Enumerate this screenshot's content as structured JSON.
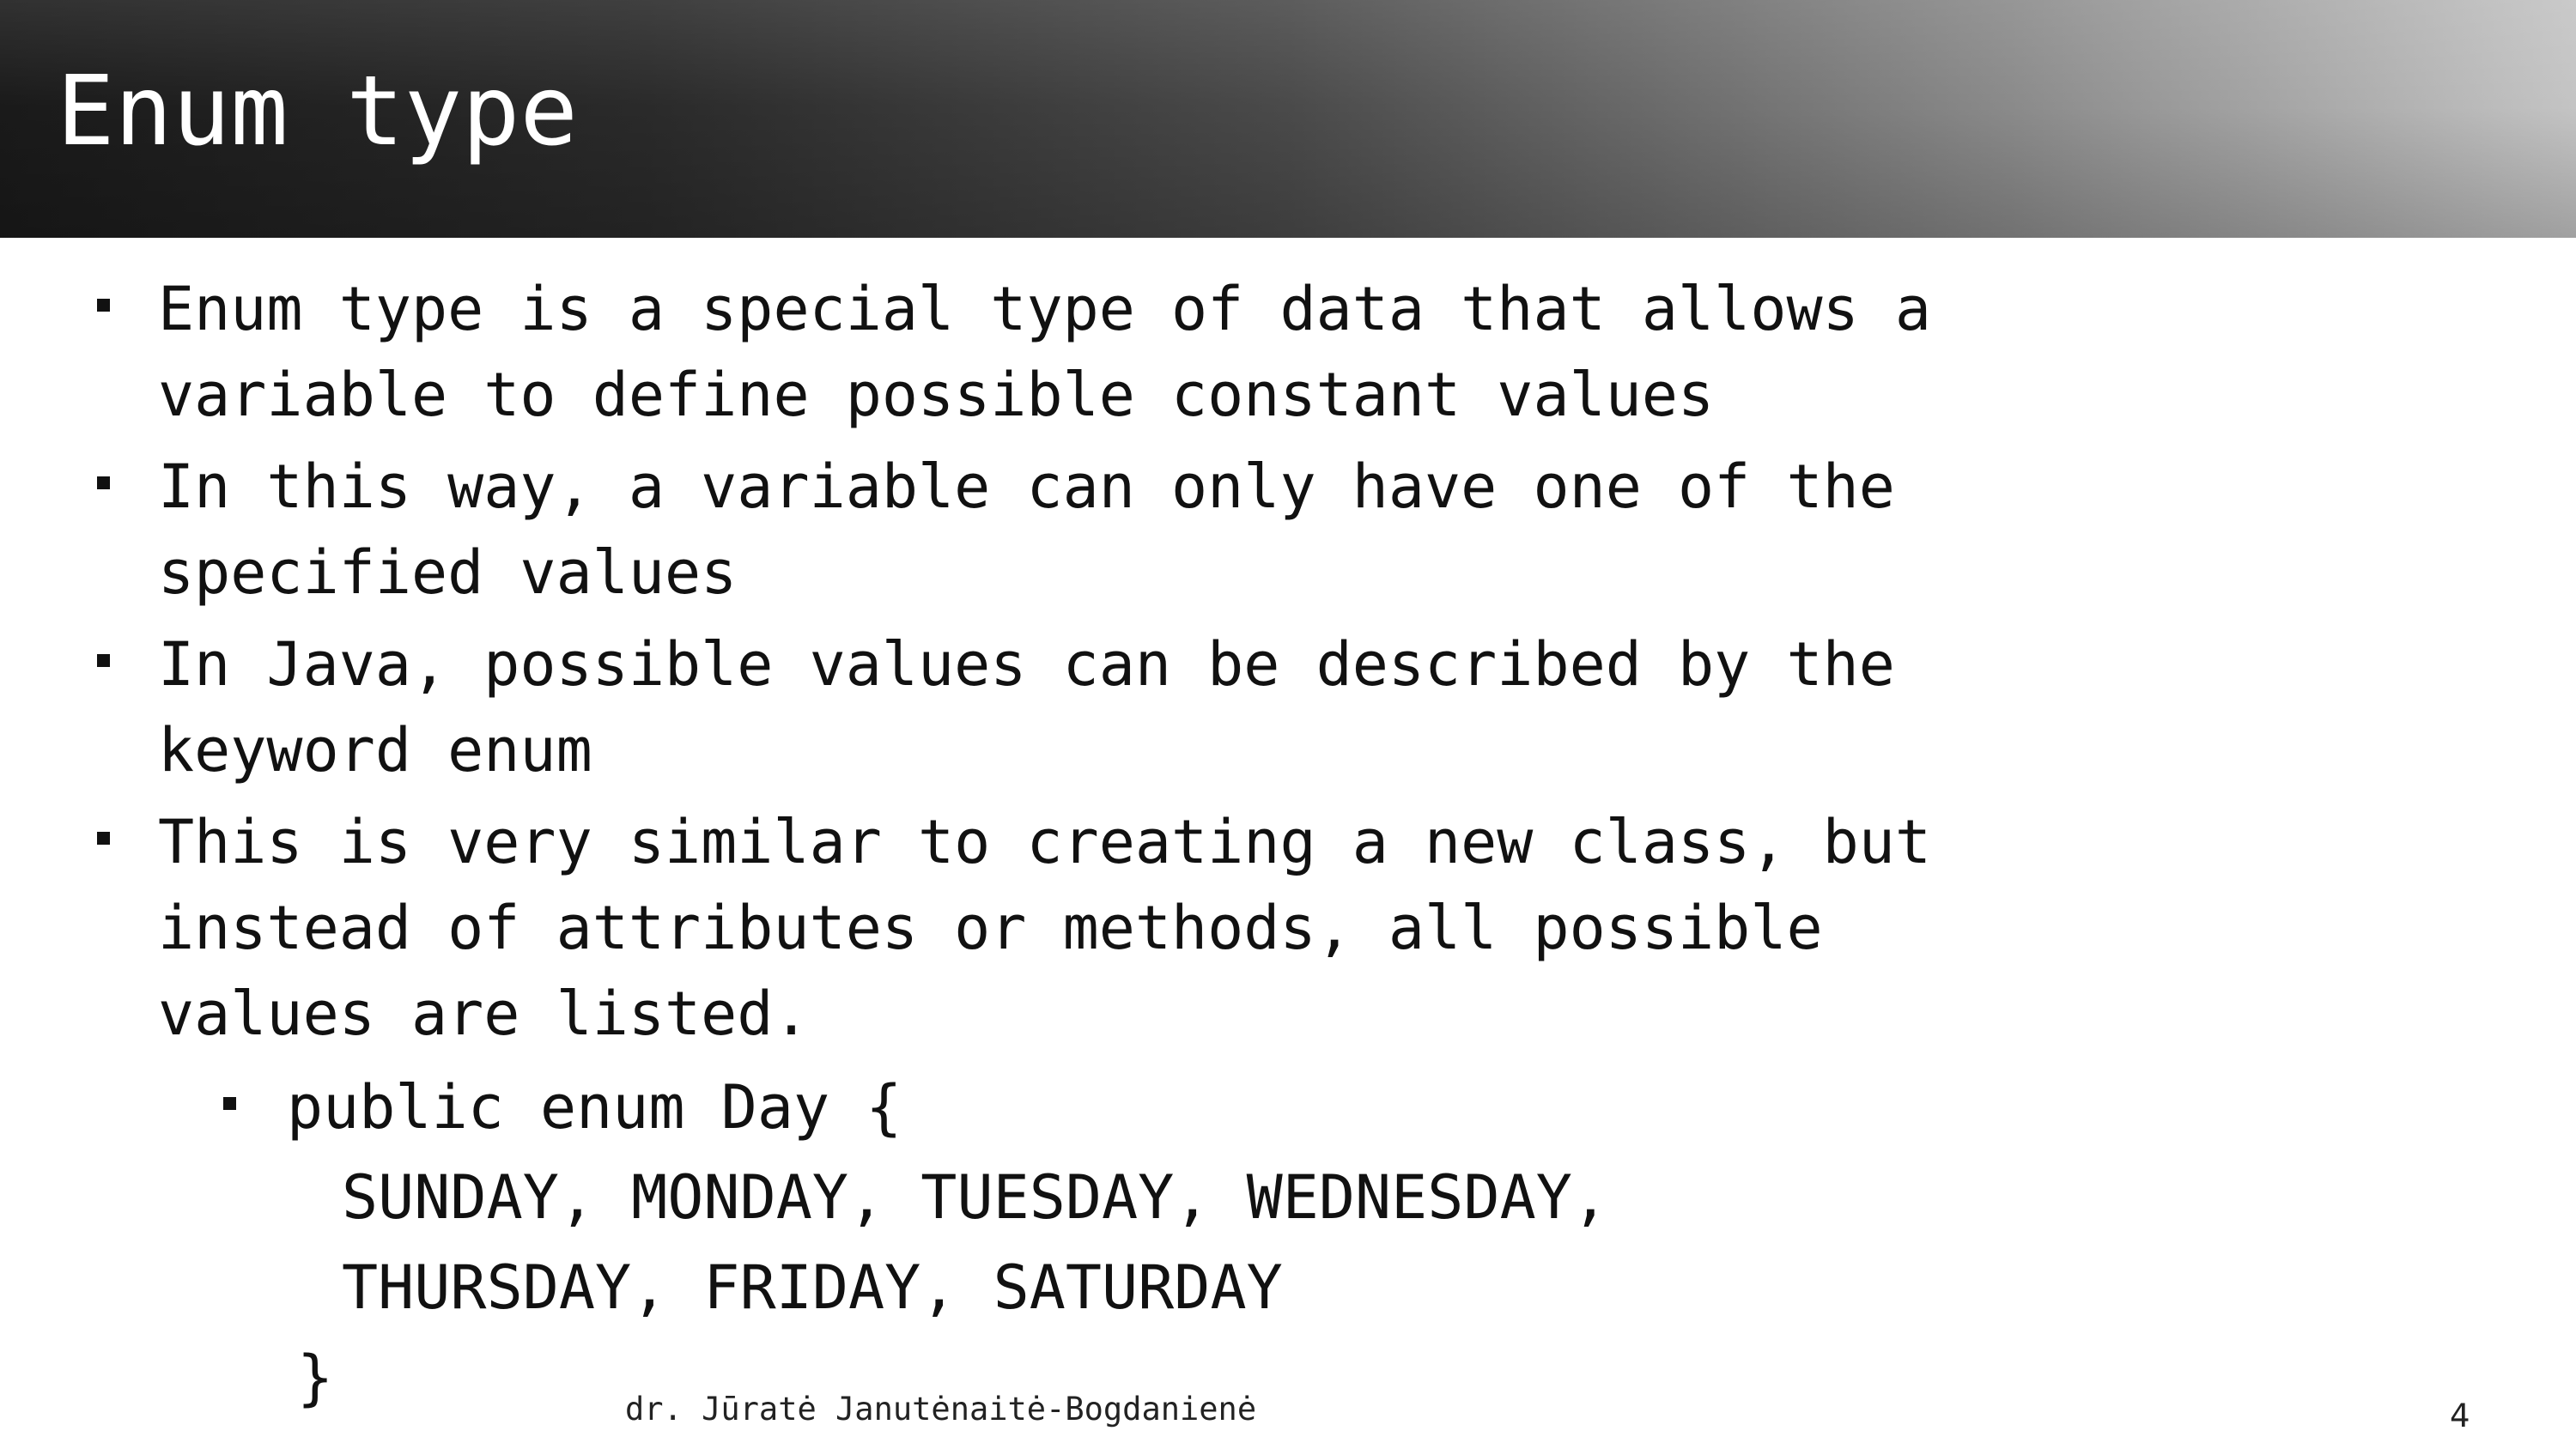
{
  "slide": {
    "title": "Enum type",
    "bullets": [
      {
        "lines": [
          "Enum type is a special type of data that allows a",
          "variable to define possible constant values"
        ]
      },
      {
        "lines": [
          "In this way, a variable can only have one of the",
          "specified values"
        ]
      },
      {
        "lines": [
          "In Java, possible values can be described by the",
          "keyword enum"
        ]
      },
      {
        "lines": [
          "This is very similar to creating a new class, but",
          "instead of attributes or methods, all possible",
          "values are listed."
        ]
      }
    ],
    "code_example": {
      "header": "public enum Day {",
      "values_line_1": "SUNDAY, MONDAY, TUESDAY, WEDNESDAY,",
      "values_line_2": "THURSDAY, FRIDAY, SATURDAY",
      "closing": "}"
    },
    "footer": {
      "author": "dr. Jūratė Janutėnaitė-Bogdanienė",
      "page_number": "4"
    }
  },
  "colors": {
    "title_text": "#ffffff",
    "body_text": "#111111",
    "title_bar_dark": "#1a1a1a",
    "title_bar_light": "#c4c4c4"
  }
}
